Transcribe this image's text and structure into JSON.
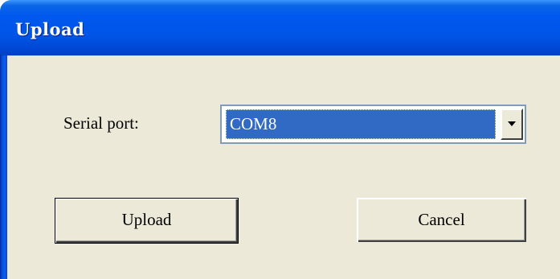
{
  "window": {
    "title": "Upload"
  },
  "form": {
    "serial_port_label": "Serial port:",
    "serial_port_value": "COM8"
  },
  "buttons": {
    "upload_label": "Upload",
    "cancel_label": "Cancel"
  },
  "colors": {
    "titlebar": "#0055e6",
    "client_background": "#ece9d8",
    "selection": "#316ac5"
  },
  "icons": {
    "dropdown": "chevron-down-icon"
  }
}
